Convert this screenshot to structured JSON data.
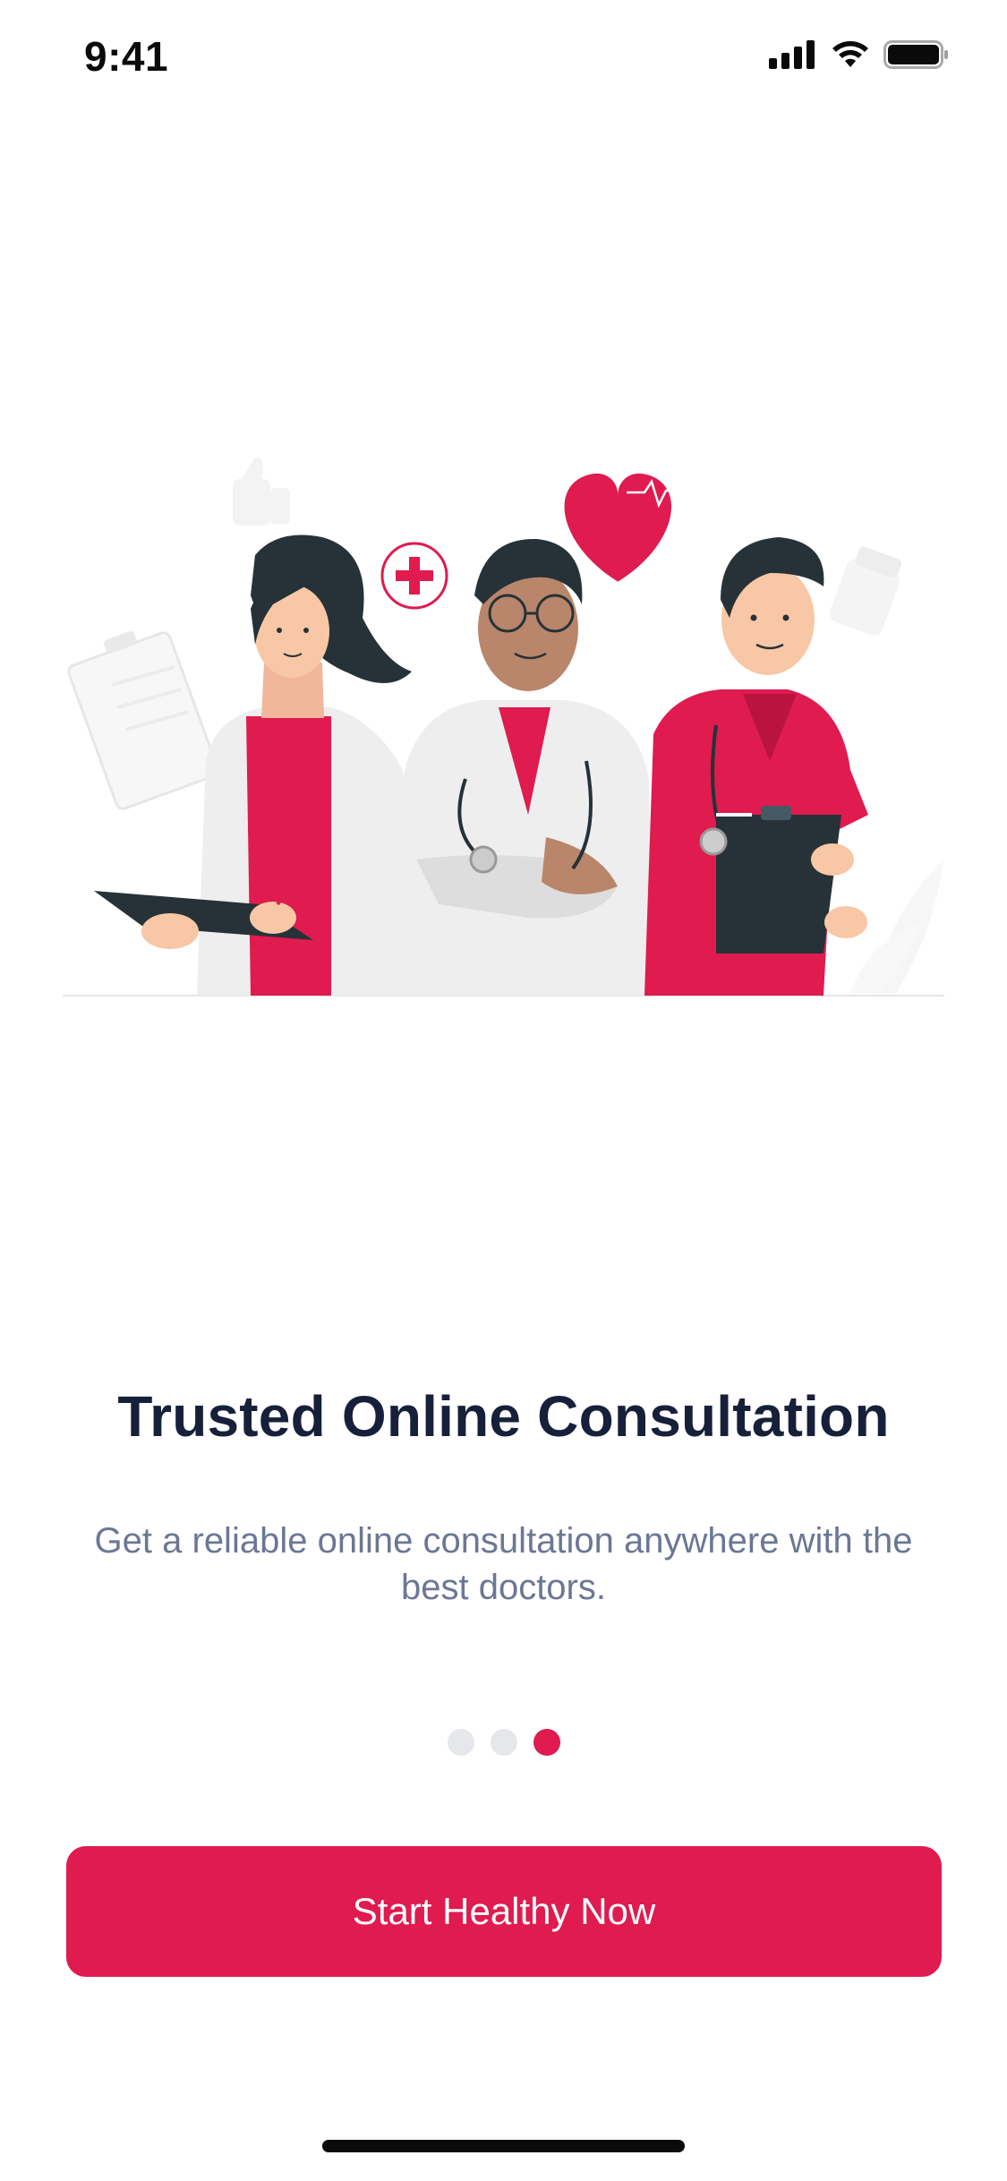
{
  "status_bar": {
    "time": "9:41",
    "icons": [
      "cellular-signal-icon",
      "wifi-icon",
      "battery-icon"
    ]
  },
  "onboarding": {
    "illustration": "doctors-illustration",
    "title": "Trusted Online Consultation",
    "subtitle": "Get a reliable online consultation anywhere with the best doctors.",
    "page_indicator": {
      "total": 3,
      "active": 3
    },
    "cta_label": "Start Healthy Now"
  },
  "colors": {
    "accent": "#DF1B4F",
    "title": "#17203A",
    "subtitle": "#6B7794",
    "inactive_dot": "#E5E7EB"
  }
}
